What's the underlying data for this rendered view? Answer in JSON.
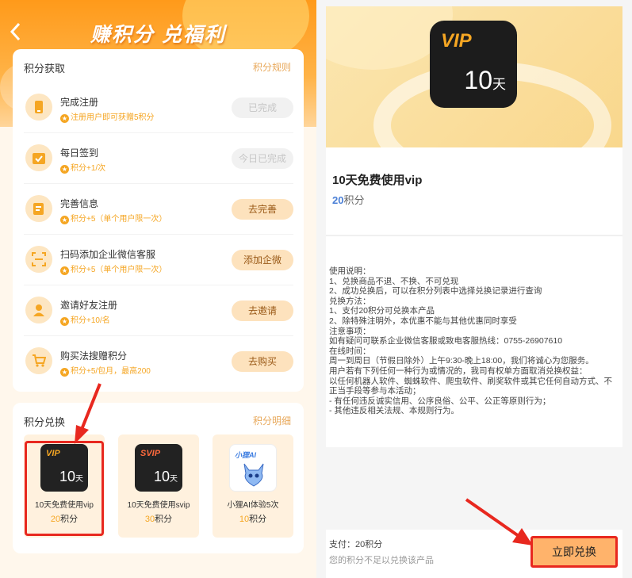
{
  "header": {
    "title": "赚积分  兑福利",
    "back_icon": "chevron-left-icon"
  },
  "earn": {
    "title": "积分获取",
    "link": "积分规则",
    "tasks": [
      {
        "name": "完成注册",
        "desc": "注册用户即可获赠5积分",
        "button": "已完成",
        "state": "done",
        "icon": "phone-icon"
      },
      {
        "name": "每日签到",
        "desc": "积分+1/次",
        "button": "今日已完成",
        "state": "done",
        "icon": "calendar-icon"
      },
      {
        "name": "完善信息",
        "desc": "积分+5（单个用户限一次）",
        "button": "去完善",
        "state": "todo",
        "icon": "clipboard-icon"
      },
      {
        "name": "扫码添加企业微信客服",
        "desc": "积分+5（单个用户限一次）",
        "button": "添加企微",
        "state": "todo",
        "icon": "scan-icon"
      },
      {
        "name": "邀请好友注册",
        "desc": "积分+10/名",
        "button": "去邀请",
        "state": "todo",
        "icon": "user-icon"
      },
      {
        "name": "购买法搜赠积分",
        "desc": "积分+5/包月，最高200",
        "button": "去购买",
        "state": "todo",
        "icon": "cart-icon"
      }
    ]
  },
  "exchange": {
    "title": "积分兑换",
    "link": "积分明细",
    "products": [
      {
        "name": "10天免费使用vip",
        "tag": "VIP",
        "days": "10",
        "unit": "天",
        "cost": "20",
        "cost_unit": "积分"
      },
      {
        "name": "10天免费使用svip",
        "tag": "SVIP",
        "days": "10",
        "unit": "天",
        "cost": "30",
        "cost_unit": "积分"
      },
      {
        "name": "小狸AI体验5次",
        "tag": "小狸AI",
        "cost": "10",
        "cost_unit": "积分"
      }
    ]
  },
  "detail": {
    "hero_tag": "VIP",
    "hero_days": "10",
    "hero_unit": "天",
    "title": "10天免费使用vip",
    "price": "20",
    "price_unit": "积分",
    "description": "使用说明：\n1、兑换商品不退、不换、不可兑现\n2、成功兑换后，可以在积分列表中选择兑换记录进行查询\n兑换方法：\n1、支付20积分可兑换本产品\n2、除特殊注明外，本优惠不能与其他优惠同时享受\n注意事项：\n如有疑问可联系企业微信客服或致电客服热线：0755-26907610\n在线时间：\n周一到周日（节假日除外）上午9:30-晚上18:00，我们将诚心为您服务。\n用户若有下列任何一种行为或情况的，我司有权单方面取消兑换权益：\n以任何机器人软件、蜘蛛软件、爬虫软件、刷奖软件或其它任何自动方式、不正当手段等参与本活动；\n- 有任何违反诚实信用、公序良俗、公平、公正等原则行为；\n- 其他违反相关法规、本规则行为。",
    "pay_text": "支付：20积分",
    "warning": "您的积分不足以兑换该产品",
    "redeem_button": "立即兑换"
  },
  "colors": {
    "accent": "#f5a623",
    "highlight": "#e8281f",
    "price_blue": "#4a7fd6"
  }
}
